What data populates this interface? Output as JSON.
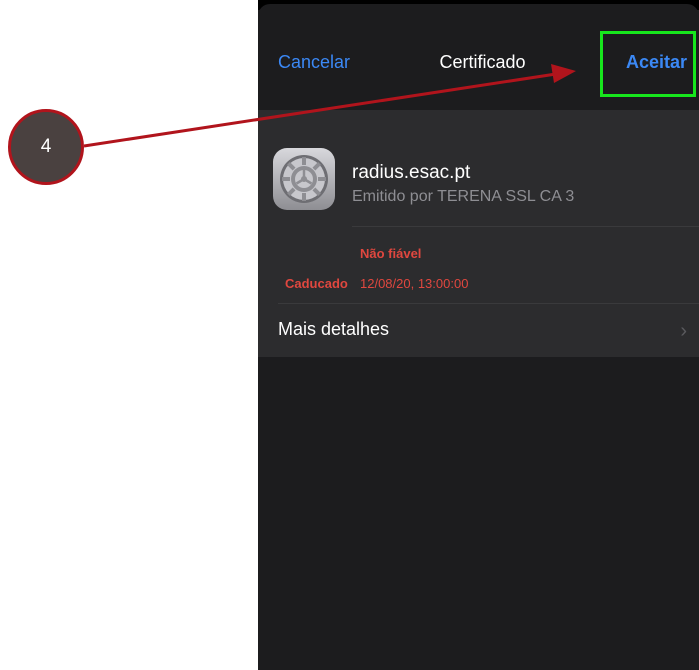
{
  "navbar": {
    "cancel_label": "Cancelar",
    "title": "Certificado",
    "accept_label": "Aceitar"
  },
  "certificate": {
    "icon": "settings-gear-icon",
    "name": "radius.esac.pt",
    "issuer": "Emitido por TERENA SSL CA 3",
    "trust_status": "Não fiável",
    "expired_label": "Caducado",
    "expired_value": "12/08/20, 13:00:00",
    "more_details_label": "Mais detalhes"
  },
  "annotation": {
    "step_number": "4"
  },
  "colors": {
    "accent": "#3b88f5",
    "warning": "#e0473f",
    "highlight": "#17e61d",
    "annotation": "#b1141c"
  }
}
